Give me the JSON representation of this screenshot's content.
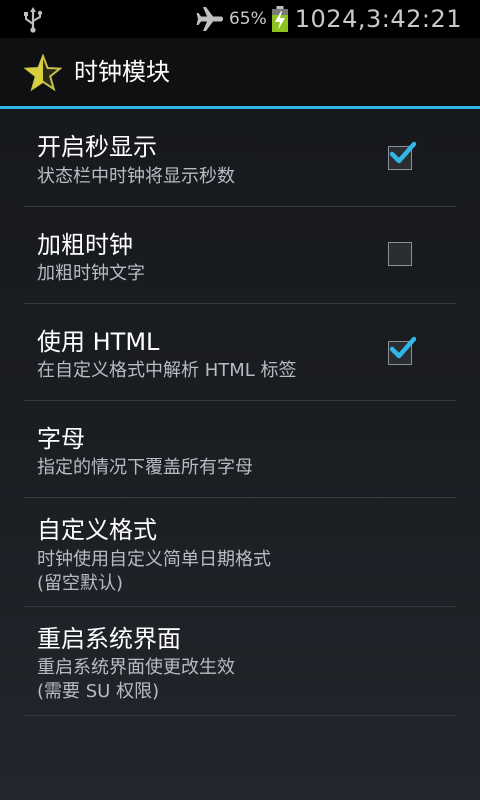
{
  "status_bar": {
    "battery_percent": "65%",
    "clock": "1024,3:42:21",
    "icons": [
      "usb-icon",
      "airplane-mode-icon",
      "battery-charging-icon"
    ]
  },
  "title_bar": {
    "title": "时钟模块",
    "icon": "star-half-icon"
  },
  "accent_color": "#33b5e5",
  "preferences": [
    {
      "title": "开启秒显示",
      "summary": "状态栏中时钟将显示秒数",
      "checkbox": true,
      "checked": true
    },
    {
      "title": "加粗时钟",
      "summary": "加粗时钟文字",
      "checkbox": true,
      "checked": false
    },
    {
      "title": "使用 HTML",
      "summary": "在自定义格式中解析 HTML 标签",
      "checkbox": true,
      "checked": true
    },
    {
      "title": "字母",
      "summary": "指定的情况下覆盖所有字母",
      "checkbox": false
    },
    {
      "title": "自定义格式",
      "summary": "时钟使用自定义简单日期格式\n(留空默认)",
      "checkbox": false
    },
    {
      "title": "重启系统界面",
      "summary": "重启系统界面使更改生效\n(需要 SU 权限)",
      "checkbox": false
    }
  ]
}
